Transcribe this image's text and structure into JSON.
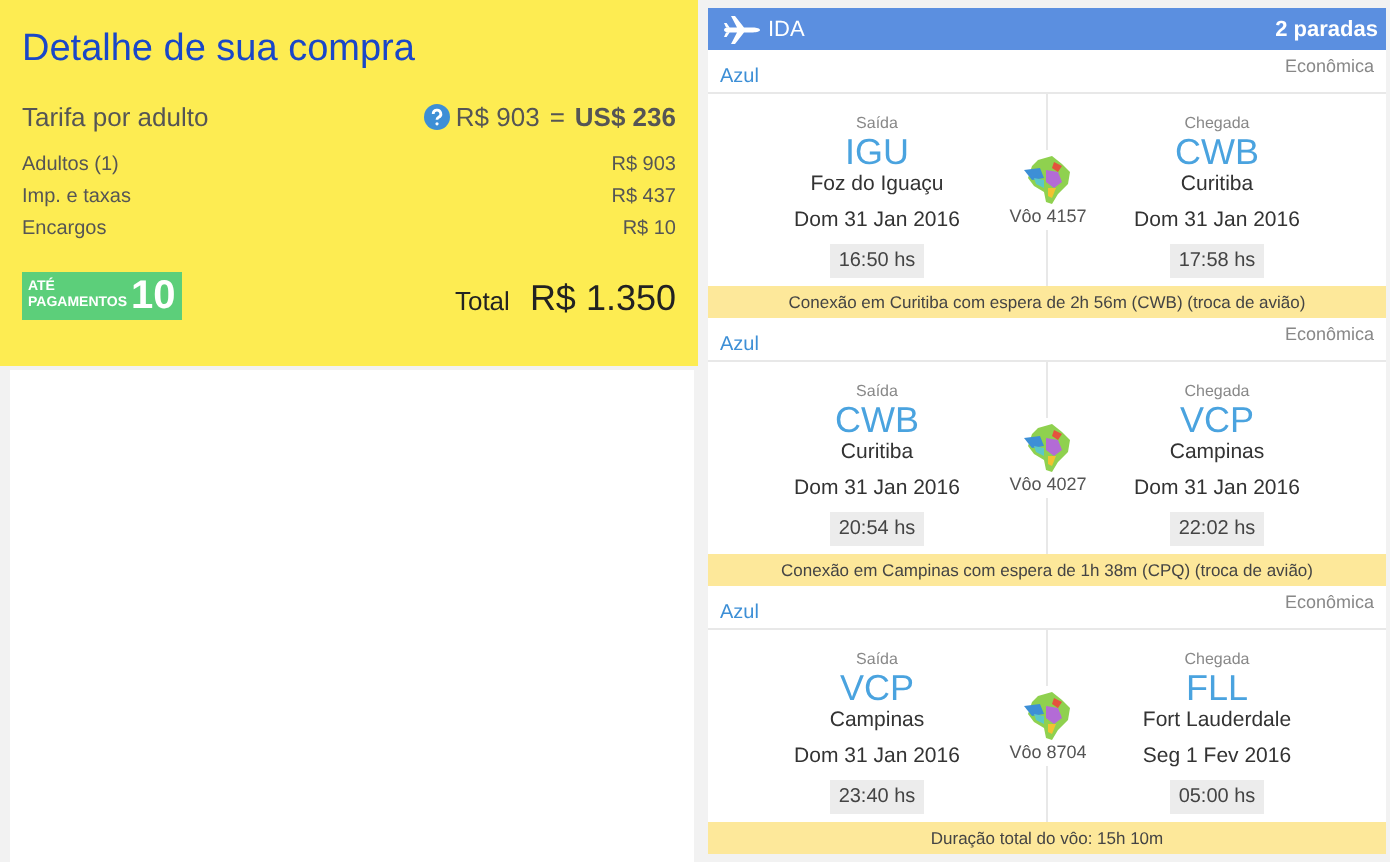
{
  "summary": {
    "title": "Detalhe de sua compra",
    "fare_label": "Tarifa por adulto",
    "fare_local": "R$ 903",
    "fare_equals": "=",
    "fare_usd": "US$ 236",
    "lines": [
      {
        "label": "Adultos (1)",
        "value": "R$ 903"
      },
      {
        "label": "Imp. e taxas",
        "value": "R$ 437"
      },
      {
        "label": "Encargos",
        "value": "R$ 10"
      }
    ],
    "installments": {
      "prefix_top": "ATÉ",
      "prefix_bottom": "PAGAMENTOS",
      "count": "10"
    },
    "total_label": "Total",
    "total_value": "R$ 1.350"
  },
  "itinerary": {
    "direction": "IDA",
    "stops": "2 paradas",
    "segments": [
      {
        "airline": "Azul",
        "cabin": "Econômica",
        "departure": {
          "label": "Saída",
          "code": "IGU",
          "city": "Foz do Iguaçu",
          "date": "Dom 31 Jan 2016",
          "time": "16:50 hs"
        },
        "flight": "Vôo 4157",
        "arrival": {
          "label": "Chegada",
          "code": "CWB",
          "city": "Curitiba",
          "date": "Dom 31 Jan 2016",
          "time": "17:58 hs"
        },
        "note": "Conexão em Curitiba com espera de 2h 56m (CWB) (troca de avião)"
      },
      {
        "airline": "Azul",
        "cabin": "Econômica",
        "departure": {
          "label": "Saída",
          "code": "CWB",
          "city": "Curitiba",
          "date": "Dom 31 Jan 2016",
          "time": "20:54 hs"
        },
        "flight": "Vôo 4027",
        "arrival": {
          "label": "Chegada",
          "code": "VCP",
          "city": "Campinas",
          "date": "Dom 31 Jan 2016",
          "time": "22:02 hs"
        },
        "note": "Conexão em Campinas com espera de 1h 38m (CPQ) (troca de avião)"
      },
      {
        "airline": "Azul",
        "cabin": "Econômica",
        "departure": {
          "label": "Saída",
          "code": "VCP",
          "city": "Campinas",
          "date": "Dom 31 Jan 2016",
          "time": "23:40 hs"
        },
        "flight": "Vôo 8704",
        "arrival": {
          "label": "Chegada",
          "code": "FLL",
          "city": "Fort Lauderdale",
          "date": "Seg 1 Fev 2016",
          "time": "05:00 hs"
        },
        "note": "Duração total do vôo: 15h 10m"
      }
    ]
  }
}
